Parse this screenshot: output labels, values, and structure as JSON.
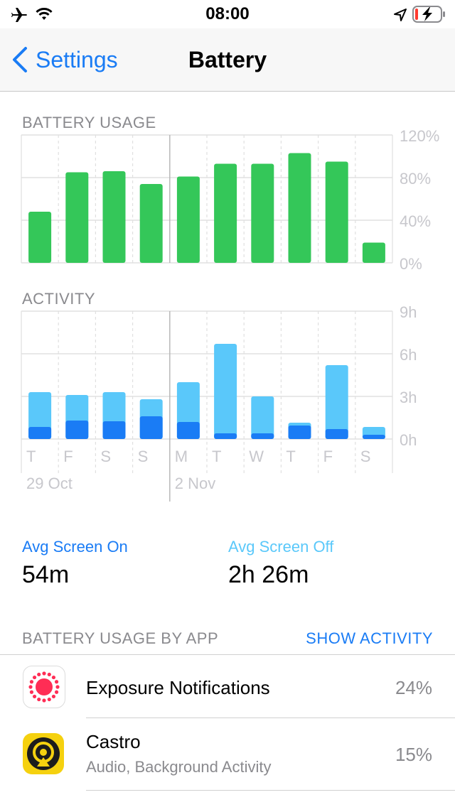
{
  "status_bar": {
    "time": "08:00",
    "icons": [
      "airplane-icon",
      "wifi-icon",
      "location-arrow-icon",
      "battery-charging-icon"
    ]
  },
  "nav": {
    "back_label": "Settings",
    "title": "Battery"
  },
  "sections": {
    "battery_usage": "BATTERY USAGE",
    "activity": "ACTIVITY",
    "usage_by_app": "BATTERY USAGE BY APP",
    "show_activity": "SHOW ACTIVITY"
  },
  "stats": {
    "screen_on_label": "Avg Screen On",
    "screen_on_value": "54m",
    "screen_off_label": "Avg Screen Off",
    "screen_off_value": "2h 26m"
  },
  "colors": {
    "accent": "#1a7cf5",
    "battery_bar": "#34c759",
    "screen_on": "#1a7cf5",
    "screen_off": "#5ac8fa",
    "grid": "#e0e0e0",
    "axis_text": "#c7c7cc"
  },
  "chart_data": [
    {
      "type": "bar",
      "title": "BATTERY USAGE",
      "categories": [
        "T",
        "F",
        "S",
        "S",
        "M",
        "T",
        "W",
        "T",
        "F",
        "S"
      ],
      "values": [
        48,
        85,
        86,
        74,
        81,
        93,
        93,
        103,
        95,
        19
      ],
      "ylim": [
        0,
        120
      ],
      "yticks": [
        "120%",
        "80%",
        "40%",
        "0%"
      ],
      "yticks_values": [
        120,
        80,
        40,
        0
      ],
      "grid": true
    },
    {
      "type": "bar",
      "title": "ACTIVITY",
      "categories": [
        "T",
        "F",
        "S",
        "S",
        "M",
        "T",
        "W",
        "T",
        "F",
        "S"
      ],
      "date_labels": [
        "29 Oct",
        "2 Nov"
      ],
      "date_label_index": [
        0,
        4
      ],
      "series": [
        {
          "name": "Avg Screen On",
          "values": [
            0.85,
            1.3,
            1.25,
            1.6,
            1.2,
            0.4,
            0.4,
            0.95,
            0.7,
            0.3
          ]
        },
        {
          "name": "Avg Screen Off",
          "values": [
            2.45,
            1.8,
            2.05,
            1.2,
            2.8,
            6.3,
            2.6,
            0.2,
            4.5,
            0.55
          ]
        }
      ],
      "stacked": true,
      "ylim": [
        0,
        9
      ],
      "yticks": [
        "9h",
        "6h",
        "3h",
        "0h"
      ],
      "yticks_values": [
        9,
        6,
        3,
        0
      ],
      "grid": true
    }
  ],
  "apps": [
    {
      "name": "Exposure Notifications",
      "subtitle": "",
      "percent": "24%",
      "icon": "exposure-notifications-icon"
    },
    {
      "name": "Castro",
      "subtitle": "Audio, Background Activity",
      "percent": "15%",
      "icon": "castro-icon"
    }
  ]
}
